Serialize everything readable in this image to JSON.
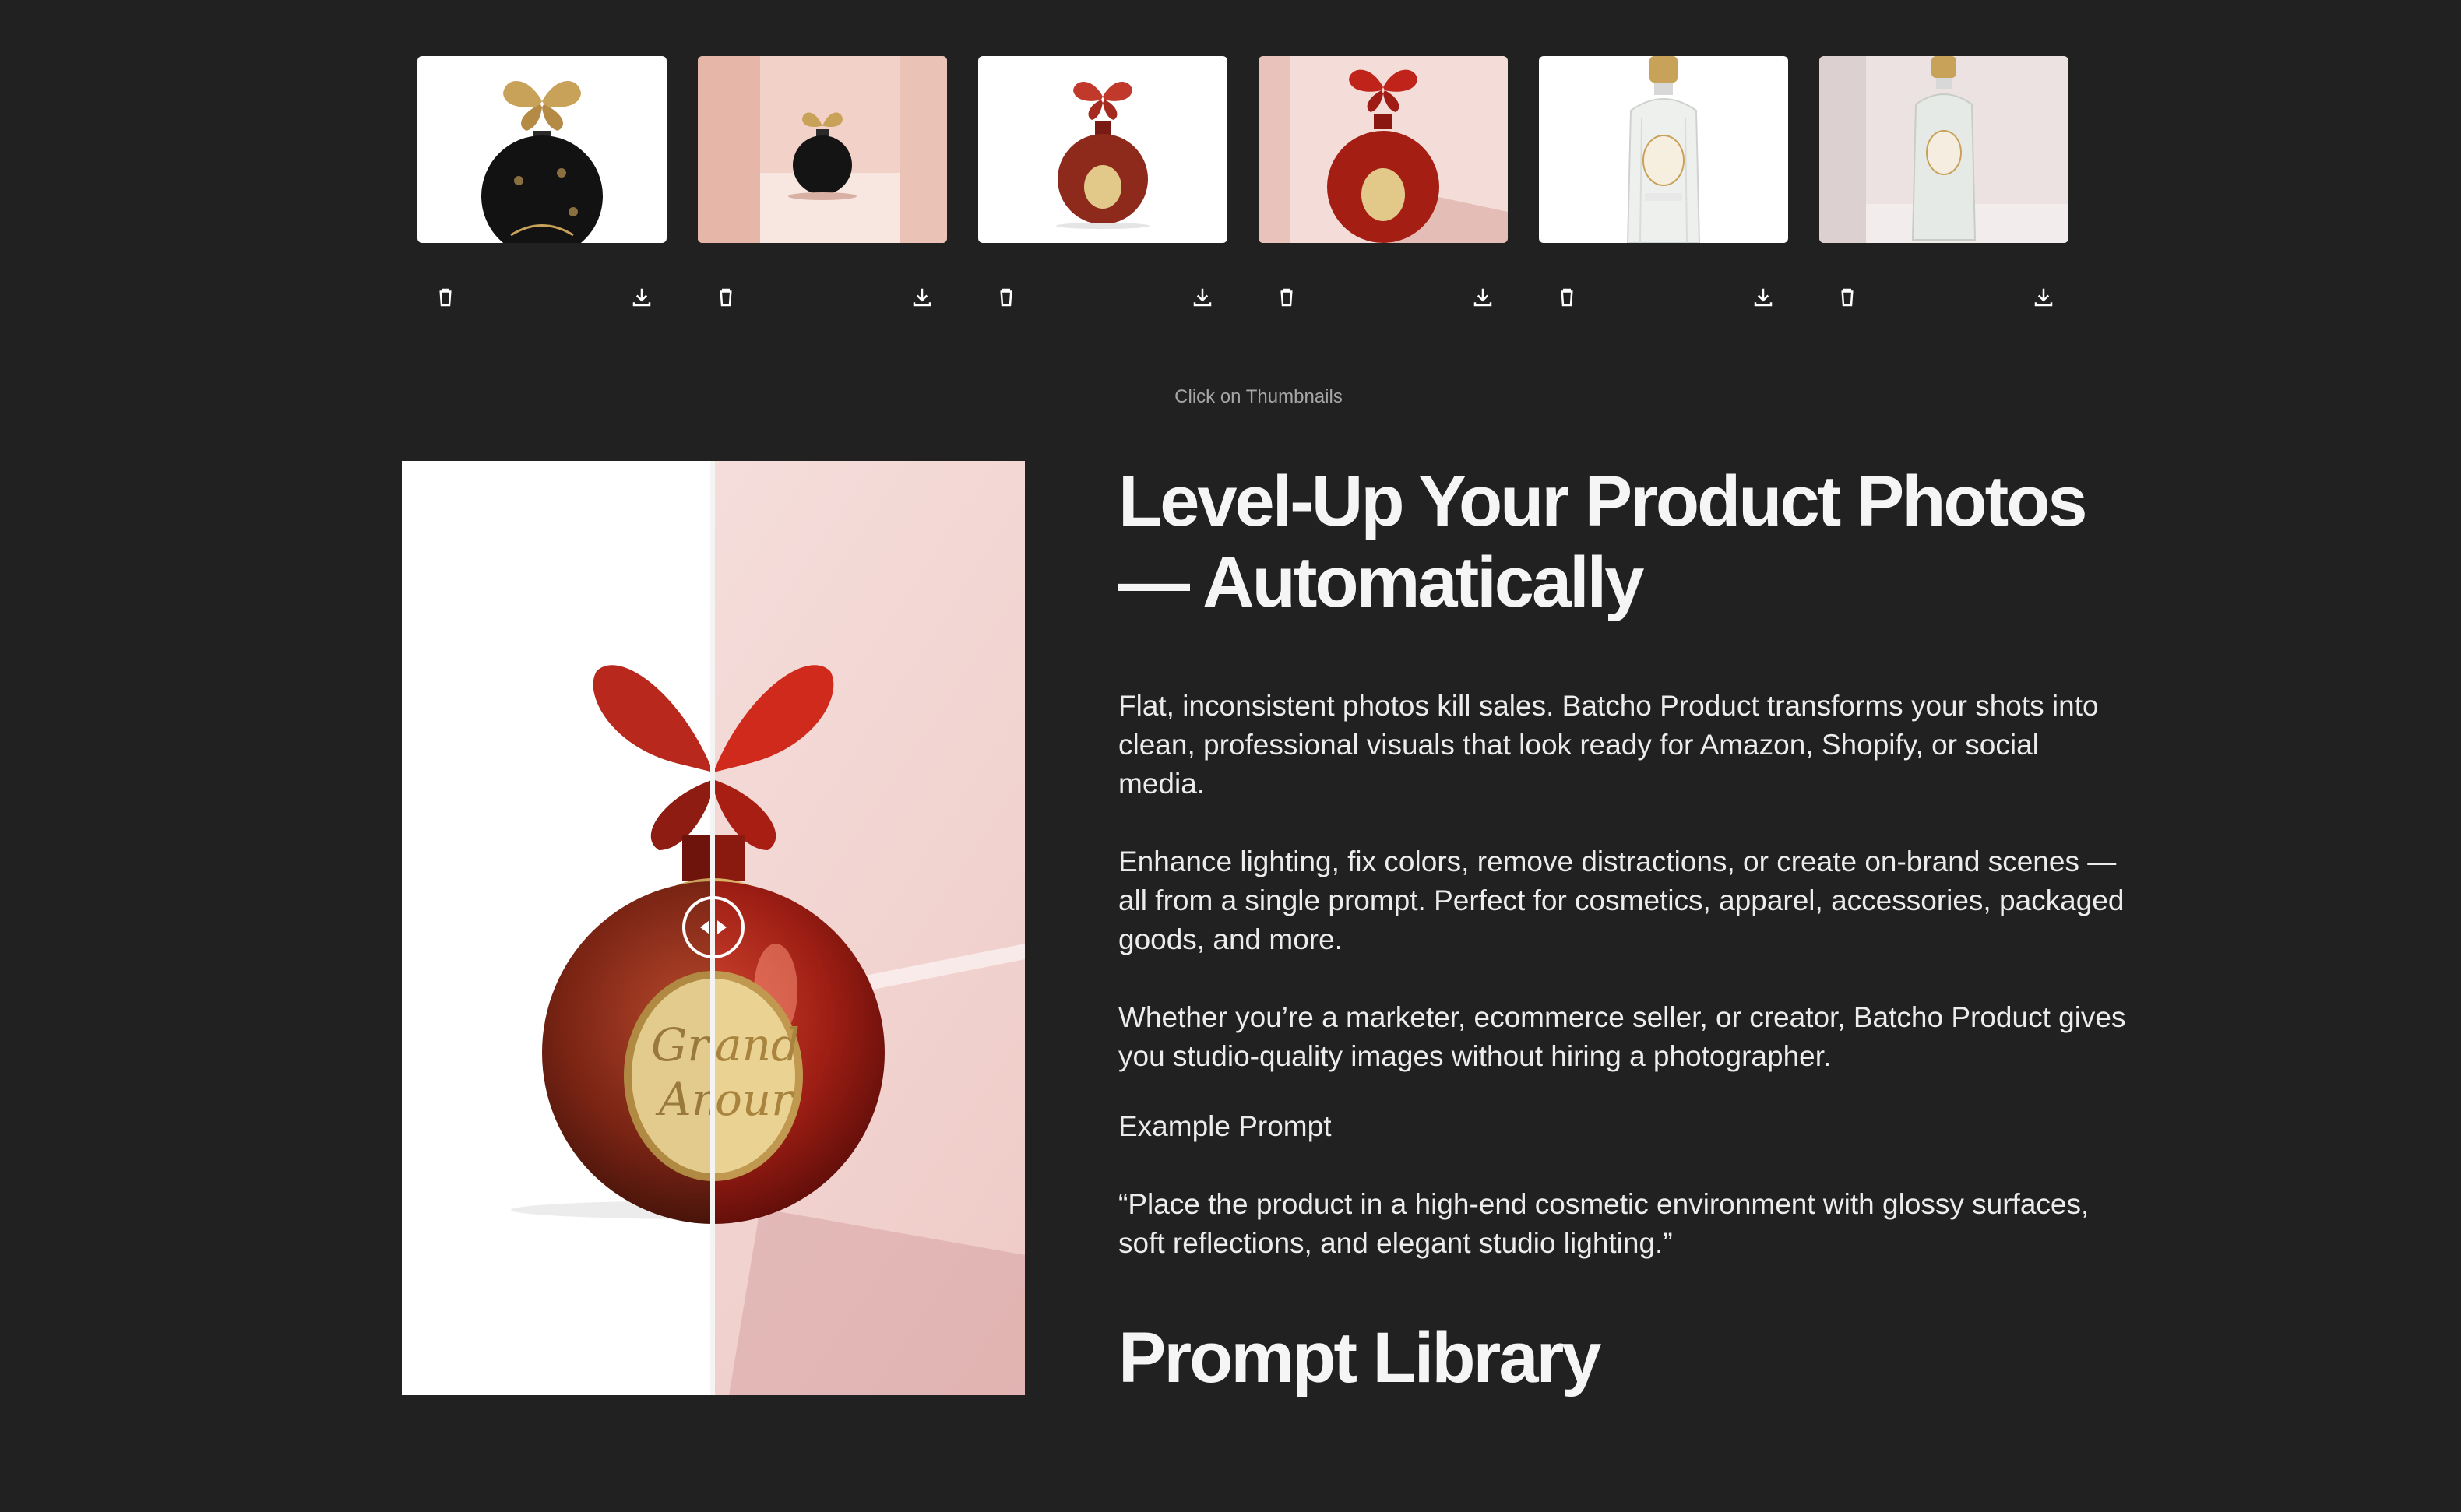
{
  "gallery": {
    "thumbnails": [
      {
        "id": "black-butterfly-white",
        "delete_icon": "trash-icon",
        "download_icon": "download-icon"
      },
      {
        "id": "black-butterfly-studio",
        "delete_icon": "trash-icon",
        "download_icon": "download-icon"
      },
      {
        "id": "red-butterfly-white",
        "delete_icon": "trash-icon",
        "download_icon": "download-icon"
      },
      {
        "id": "red-butterfly-studio",
        "delete_icon": "trash-icon",
        "download_icon": "download-icon"
      },
      {
        "id": "clear-bottle-white",
        "delete_icon": "trash-icon",
        "download_icon": "download-icon"
      },
      {
        "id": "clear-bottle-studio",
        "delete_icon": "trash-icon",
        "download_icon": "download-icon"
      }
    ],
    "hint": "Click on Thumbnails"
  },
  "compare": {
    "before_label": "",
    "after_label": "",
    "handle_icon": "left-right-arrows-icon"
  },
  "intro": {
    "headline": "Level-Up Your Product Photos — Automatically",
    "paragraph_1": "Flat, inconsistent photos kill sales. Batcho Product transforms your shots into clean, professional visuals that look ready for Amazon, Shopify, or social media.",
    "paragraph_2": "Enhance lighting, fix colors, remove distractions, or create on-brand scenes — all from a single prompt. Perfect for cosmetics, apparel, accessories, packaged goods, and more.",
    "paragraph_3": "Whether you’re a marketer, ecommerce seller, or creator, Batcho Product gives you studio-quality images without hiring a photographer.",
    "example_label": "Example Prompt",
    "example_prompt": "“Place the product in a high-end cosmetic environment with glossy surfaces, soft reflections, and elegant studio lighting.”"
  },
  "library": {
    "title": "Prompt Library"
  },
  "colors": {
    "background": "#212121",
    "text": "#f2f2f2",
    "muted": "#a6a6a6",
    "bottle_red": "#b3231c",
    "gold": "#c9a25a"
  }
}
